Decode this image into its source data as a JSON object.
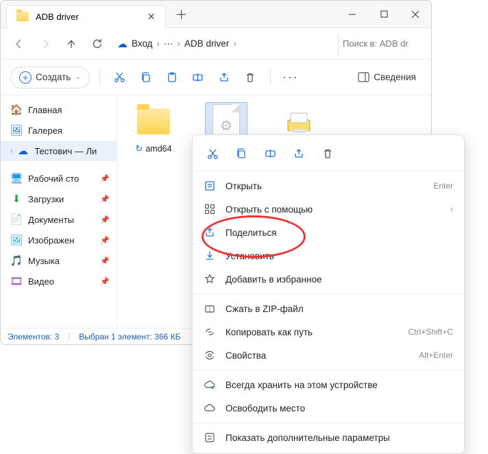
{
  "tab": {
    "title": "ADB driver"
  },
  "breadcrumb": {
    "entry_label": "Вход",
    "dots": "···",
    "current": "ADB driver"
  },
  "search": {
    "placeholder": "Поиск в: ADB dr"
  },
  "toolbar": {
    "create_label": "Создать",
    "details_label": "Сведения"
  },
  "sidebar": {
    "home": "Главная",
    "gallery": "Галерея",
    "onedrive": "Тестович — Ли",
    "desktop": "Рабочий сто",
    "downloads": "Загрузки",
    "documents": "Документы",
    "pictures": "Изображен",
    "music": "Музыка",
    "videos": "Видео"
  },
  "files": {
    "amd64": "amd64"
  },
  "status": {
    "count": "Элементов: 3",
    "selection": "Выбран 1 элемент: 366 КБ"
  },
  "context": {
    "open": "Открыть",
    "open_hint": "Enter",
    "open_with": "Открыть с помощью",
    "share": "Поделиться",
    "install": "Установить",
    "favorite": "Добавить в избранное",
    "zip": "Сжать в ZIP-файл",
    "copy_path": "Копировать как путь",
    "copy_path_hint": "Ctrl+Shift+C",
    "properties": "Свойства",
    "properties_hint": "Alt+Enter",
    "keep_device": "Всегда хранить на этом устройстве",
    "free_space": "Освободить место",
    "more_options": "Показать дополнительные параметры"
  }
}
